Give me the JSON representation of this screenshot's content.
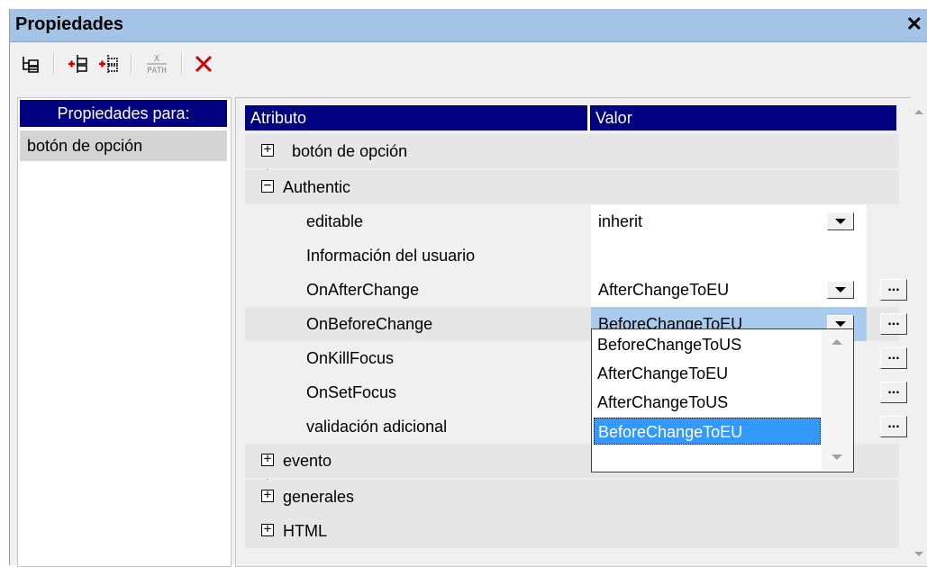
{
  "window": {
    "title": "Propiedades",
    "close_label": "✕"
  },
  "toolbar": {
    "buttons": [
      {
        "name": "tree-view-icon"
      },
      {
        "name": "add-child-icon"
      },
      {
        "name": "add-sibling-icon"
      },
      {
        "name": "xpath-icon",
        "label": "PATH"
      },
      {
        "name": "delete-icon"
      }
    ]
  },
  "left_panel": {
    "header": "Propiedades para:",
    "item": "botón de opción"
  },
  "grid": {
    "header_attr": "Atributo",
    "header_val": "Valor",
    "rows": {
      "boton": "botón de opción",
      "authentic": "Authentic",
      "editable": "editable",
      "editable_value": "inherit",
      "info": "Información del usuario",
      "onafter": "OnAfterChange",
      "onafter_value": "AfterChangeToEU",
      "onbefore": "OnBeforeChange",
      "onbefore_value": "BeforeChangeToEU",
      "onkill": "OnKillFocus",
      "onset": "OnSetFocus",
      "validacion": "validación adicional",
      "evento": "evento",
      "generales": "generales",
      "html": "HTML"
    },
    "ellipsis_label": "..."
  },
  "dropdown": {
    "options": [
      "BeforeChangeToUS",
      "AfterChangeToEU",
      "AfterChangeToUS",
      "BeforeChangeToEU"
    ],
    "selected": "BeforeChangeToEU"
  },
  "colors": {
    "header_bg": "#000080",
    "titlebar_bg": "#a3c4e6",
    "selection": "#3399ff"
  }
}
